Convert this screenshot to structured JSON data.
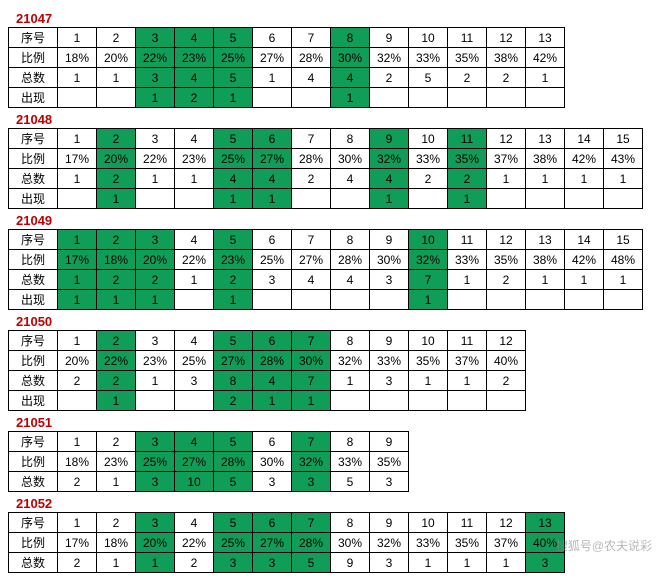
{
  "labels": {
    "xuhao": "序号",
    "bili": "比例",
    "zongshu": "总数",
    "chuxian": "出现"
  },
  "watermark": "搜狐号@农夫说彩",
  "sections": [
    {
      "id": "21047",
      "cols": 13,
      "rows": [
        {
          "label": "xuhao",
          "cells": [
            {
              "v": "1"
            },
            {
              "v": "2"
            },
            {
              "v": "3",
              "h": 1
            },
            {
              "v": "4",
              "h": 1
            },
            {
              "v": "5",
              "h": 1
            },
            {
              "v": "6"
            },
            {
              "v": "7"
            },
            {
              "v": "8",
              "h": 1
            },
            {
              "v": "9"
            },
            {
              "v": "10"
            },
            {
              "v": "11"
            },
            {
              "v": "12"
            },
            {
              "v": "13"
            }
          ]
        },
        {
          "label": "bili",
          "cells": [
            {
              "v": "18%"
            },
            {
              "v": "20%"
            },
            {
              "v": "22%",
              "h": 1
            },
            {
              "v": "23%",
              "h": 1
            },
            {
              "v": "25%",
              "h": 1
            },
            {
              "v": "27%"
            },
            {
              "v": "28%"
            },
            {
              "v": "30%",
              "h": 1
            },
            {
              "v": "32%"
            },
            {
              "v": "33%"
            },
            {
              "v": "35%"
            },
            {
              "v": "38%"
            },
            {
              "v": "42%"
            }
          ]
        },
        {
          "label": "zongshu",
          "cells": [
            {
              "v": "1"
            },
            {
              "v": "1"
            },
            {
              "v": "3",
              "h": 1
            },
            {
              "v": "4",
              "h": 1
            },
            {
              "v": "5",
              "h": 1
            },
            {
              "v": "1"
            },
            {
              "v": "4"
            },
            {
              "v": "4",
              "h": 1
            },
            {
              "v": "2"
            },
            {
              "v": "5"
            },
            {
              "v": "2"
            },
            {
              "v": "2"
            },
            {
              "v": "1"
            }
          ]
        },
        {
          "label": "chuxian",
          "cells": [
            {
              "v": ""
            },
            {
              "v": ""
            },
            {
              "v": "1",
              "h": 1
            },
            {
              "v": "2",
              "h": 1
            },
            {
              "v": "1",
              "h": 1
            },
            {
              "v": ""
            },
            {
              "v": ""
            },
            {
              "v": "1",
              "h": 1
            },
            {
              "v": ""
            },
            {
              "v": ""
            },
            {
              "v": ""
            },
            {
              "v": ""
            },
            {
              "v": ""
            }
          ]
        }
      ]
    },
    {
      "id": "21048",
      "cols": 15,
      "rows": [
        {
          "label": "xuhao",
          "cells": [
            {
              "v": "1"
            },
            {
              "v": "2",
              "h": 1
            },
            {
              "v": "3"
            },
            {
              "v": "4"
            },
            {
              "v": "5",
              "h": 1
            },
            {
              "v": "6",
              "h": 1
            },
            {
              "v": "7"
            },
            {
              "v": "8"
            },
            {
              "v": "9",
              "h": 1
            },
            {
              "v": "10"
            },
            {
              "v": "11",
              "h": 1
            },
            {
              "v": "12"
            },
            {
              "v": "13"
            },
            {
              "v": "14"
            },
            {
              "v": "15"
            }
          ]
        },
        {
          "label": "bili",
          "cells": [
            {
              "v": "17%"
            },
            {
              "v": "20%",
              "h": 1
            },
            {
              "v": "22%"
            },
            {
              "v": "23%"
            },
            {
              "v": "25%",
              "h": 1
            },
            {
              "v": "27%",
              "h": 1
            },
            {
              "v": "28%"
            },
            {
              "v": "30%"
            },
            {
              "v": "32%",
              "h": 1
            },
            {
              "v": "33%"
            },
            {
              "v": "35%",
              "h": 1
            },
            {
              "v": "37%"
            },
            {
              "v": "38%"
            },
            {
              "v": "42%"
            },
            {
              "v": "43%"
            }
          ]
        },
        {
          "label": "zongshu",
          "cells": [
            {
              "v": "1"
            },
            {
              "v": "2",
              "h": 1
            },
            {
              "v": "1"
            },
            {
              "v": "1"
            },
            {
              "v": "4",
              "h": 1
            },
            {
              "v": "4",
              "h": 1
            },
            {
              "v": "2"
            },
            {
              "v": "4"
            },
            {
              "v": "4",
              "h": 1
            },
            {
              "v": "2"
            },
            {
              "v": "2",
              "h": 1
            },
            {
              "v": "1"
            },
            {
              "v": "1"
            },
            {
              "v": "1"
            },
            {
              "v": "1"
            }
          ]
        },
        {
          "label": "chuxian",
          "cells": [
            {
              "v": ""
            },
            {
              "v": "1",
              "h": 1
            },
            {
              "v": ""
            },
            {
              "v": ""
            },
            {
              "v": "1",
              "h": 1
            },
            {
              "v": "1",
              "h": 1
            },
            {
              "v": ""
            },
            {
              "v": ""
            },
            {
              "v": "1",
              "h": 1
            },
            {
              "v": ""
            },
            {
              "v": "1",
              "h": 1
            },
            {
              "v": ""
            },
            {
              "v": ""
            },
            {
              "v": ""
            },
            {
              "v": ""
            }
          ]
        }
      ]
    },
    {
      "id": "21049",
      "cols": 15,
      "rows": [
        {
          "label": "xuhao",
          "cells": [
            {
              "v": "1",
              "h": 1
            },
            {
              "v": "2",
              "h": 1
            },
            {
              "v": "3",
              "h": 1
            },
            {
              "v": "4"
            },
            {
              "v": "5",
              "h": 1
            },
            {
              "v": "6"
            },
            {
              "v": "7"
            },
            {
              "v": "8"
            },
            {
              "v": "9"
            },
            {
              "v": "10",
              "h": 1
            },
            {
              "v": "11"
            },
            {
              "v": "12"
            },
            {
              "v": "13"
            },
            {
              "v": "14"
            },
            {
              "v": "15"
            }
          ]
        },
        {
          "label": "bili",
          "cells": [
            {
              "v": "17%",
              "h": 1
            },
            {
              "v": "18%",
              "h": 1
            },
            {
              "v": "20%",
              "h": 1
            },
            {
              "v": "22%"
            },
            {
              "v": "23%",
              "h": 1
            },
            {
              "v": "25%"
            },
            {
              "v": "27%"
            },
            {
              "v": "28%"
            },
            {
              "v": "30%"
            },
            {
              "v": "32%",
              "h": 1
            },
            {
              "v": "33%"
            },
            {
              "v": "35%"
            },
            {
              "v": "38%"
            },
            {
              "v": "42%"
            },
            {
              "v": "48%"
            }
          ]
        },
        {
          "label": "zongshu",
          "cells": [
            {
              "v": "1",
              "h": 1
            },
            {
              "v": "2",
              "h": 1
            },
            {
              "v": "2",
              "h": 1
            },
            {
              "v": "1"
            },
            {
              "v": "2",
              "h": 1
            },
            {
              "v": "3"
            },
            {
              "v": "4"
            },
            {
              "v": "4"
            },
            {
              "v": "3"
            },
            {
              "v": "7",
              "h": 1
            },
            {
              "v": "1"
            },
            {
              "v": "2"
            },
            {
              "v": "1"
            },
            {
              "v": "1"
            },
            {
              "v": "1"
            }
          ]
        },
        {
          "label": "chuxian",
          "cells": [
            {
              "v": "1",
              "h": 1
            },
            {
              "v": "1",
              "h": 1
            },
            {
              "v": "1",
              "h": 1
            },
            {
              "v": ""
            },
            {
              "v": "1",
              "h": 1
            },
            {
              "v": ""
            },
            {
              "v": ""
            },
            {
              "v": ""
            },
            {
              "v": ""
            },
            {
              "v": "1",
              "h": 1
            },
            {
              "v": ""
            },
            {
              "v": ""
            },
            {
              "v": ""
            },
            {
              "v": ""
            },
            {
              "v": ""
            }
          ]
        }
      ]
    },
    {
      "id": "21050",
      "cols": 12,
      "rows": [
        {
          "label": "xuhao",
          "cells": [
            {
              "v": "1"
            },
            {
              "v": "2",
              "h": 1
            },
            {
              "v": "3"
            },
            {
              "v": "4"
            },
            {
              "v": "5",
              "h": 1
            },
            {
              "v": "6",
              "h": 1
            },
            {
              "v": "7",
              "h": 1
            },
            {
              "v": "8"
            },
            {
              "v": "9"
            },
            {
              "v": "10"
            },
            {
              "v": "11"
            },
            {
              "v": "12"
            }
          ]
        },
        {
          "label": "bili",
          "cells": [
            {
              "v": "20%"
            },
            {
              "v": "22%",
              "h": 1
            },
            {
              "v": "23%"
            },
            {
              "v": "25%"
            },
            {
              "v": "27%",
              "h": 1
            },
            {
              "v": "28%",
              "h": 1
            },
            {
              "v": "30%",
              "h": 1
            },
            {
              "v": "32%"
            },
            {
              "v": "33%"
            },
            {
              "v": "35%"
            },
            {
              "v": "37%"
            },
            {
              "v": "40%"
            }
          ]
        },
        {
          "label": "zongshu",
          "cells": [
            {
              "v": "2"
            },
            {
              "v": "2",
              "h": 1
            },
            {
              "v": "1"
            },
            {
              "v": "3"
            },
            {
              "v": "8",
              "h": 1
            },
            {
              "v": "4",
              "h": 1
            },
            {
              "v": "7",
              "h": 1
            },
            {
              "v": "1"
            },
            {
              "v": "3"
            },
            {
              "v": "1"
            },
            {
              "v": "1"
            },
            {
              "v": "2"
            }
          ]
        },
        {
          "label": "chuxian",
          "cells": [
            {
              "v": ""
            },
            {
              "v": "1",
              "h": 1
            },
            {
              "v": ""
            },
            {
              "v": ""
            },
            {
              "v": "2",
              "h": 1
            },
            {
              "v": "1",
              "h": 1
            },
            {
              "v": "1",
              "h": 1
            },
            {
              "v": ""
            },
            {
              "v": ""
            },
            {
              "v": ""
            },
            {
              "v": ""
            },
            {
              "v": ""
            }
          ]
        }
      ]
    },
    {
      "id": "21051",
      "cols": 9,
      "rows": [
        {
          "label": "xuhao",
          "cells": [
            {
              "v": "1"
            },
            {
              "v": "2"
            },
            {
              "v": "3",
              "h": 1
            },
            {
              "v": "4",
              "h": 1
            },
            {
              "v": "5",
              "h": 1
            },
            {
              "v": "6"
            },
            {
              "v": "7",
              "h": 1
            },
            {
              "v": "8"
            },
            {
              "v": "9"
            }
          ]
        },
        {
          "label": "bili",
          "cells": [
            {
              "v": "18%"
            },
            {
              "v": "23%"
            },
            {
              "v": "25%",
              "h": 1
            },
            {
              "v": "27%",
              "h": 1
            },
            {
              "v": "28%",
              "h": 1
            },
            {
              "v": "30%"
            },
            {
              "v": "32%",
              "h": 1
            },
            {
              "v": "33%"
            },
            {
              "v": "35%"
            }
          ]
        },
        {
          "label": "zongshu",
          "cells": [
            {
              "v": "2"
            },
            {
              "v": "1"
            },
            {
              "v": "3",
              "h": 1
            },
            {
              "v": "10",
              "h": 1
            },
            {
              "v": "5",
              "h": 1
            },
            {
              "v": "3"
            },
            {
              "v": "3",
              "h": 1
            },
            {
              "v": "5"
            },
            {
              "v": "3"
            }
          ]
        }
      ]
    },
    {
      "id": "21052",
      "cols": 13,
      "rows": [
        {
          "label": "xuhao",
          "cells": [
            {
              "v": "1"
            },
            {
              "v": "2"
            },
            {
              "v": "3",
              "h": 1
            },
            {
              "v": "4"
            },
            {
              "v": "5",
              "h": 1
            },
            {
              "v": "6",
              "h": 1
            },
            {
              "v": "7",
              "h": 1
            },
            {
              "v": "8"
            },
            {
              "v": "9"
            },
            {
              "v": "10"
            },
            {
              "v": "11"
            },
            {
              "v": "12"
            },
            {
              "v": "13",
              "h": 1
            }
          ]
        },
        {
          "label": "bili",
          "cells": [
            {
              "v": "17%"
            },
            {
              "v": "18%"
            },
            {
              "v": "20%",
              "h": 1
            },
            {
              "v": "22%"
            },
            {
              "v": "25%",
              "h": 1
            },
            {
              "v": "27%",
              "h": 1
            },
            {
              "v": "28%",
              "h": 1
            },
            {
              "v": "30%"
            },
            {
              "v": "32%"
            },
            {
              "v": "33%"
            },
            {
              "v": "35%"
            },
            {
              "v": "37%"
            },
            {
              "v": "40%",
              "h": 1
            }
          ]
        },
        {
          "label": "zongshu",
          "cells": [
            {
              "v": "2"
            },
            {
              "v": "1"
            },
            {
              "v": "1",
              "h": 1
            },
            {
              "v": "2"
            },
            {
              "v": "3",
              "h": 1
            },
            {
              "v": "3",
              "h": 1
            },
            {
              "v": "5",
              "h": 1
            },
            {
              "v": "9"
            },
            {
              "v": "3"
            },
            {
              "v": "1"
            },
            {
              "v": "1"
            },
            {
              "v": "1"
            },
            {
              "v": "3",
              "h": 1
            }
          ]
        }
      ]
    }
  ]
}
